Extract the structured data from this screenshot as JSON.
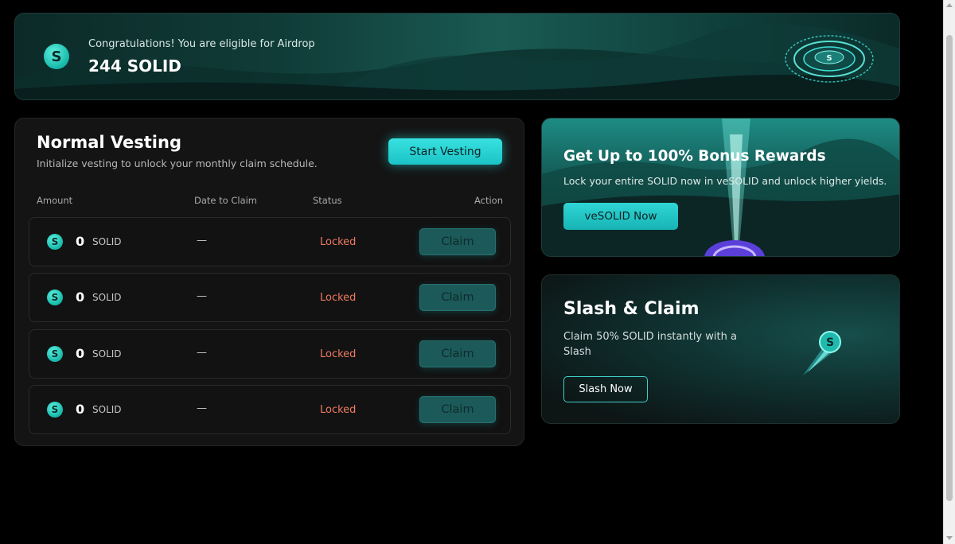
{
  "banner": {
    "subtitle": "Congratulations! You are eligible for Airdrop",
    "amount": "244 SOLID",
    "logo_icon": "solid-logo-icon",
    "ring_icon": "portal-ring-icon"
  },
  "vesting": {
    "title": "Normal Vesting",
    "description": "Initialize vesting to unlock your monthly claim schedule.",
    "start_button": "Start Vesting",
    "columns": [
      "Amount",
      "Date to Claim",
      "Status",
      "Action"
    ],
    "rows": [
      {
        "amount": "0",
        "unit": "SOLID",
        "date": "—",
        "status": "Locked",
        "action": "Claim"
      },
      {
        "amount": "0",
        "unit": "SOLID",
        "date": "—",
        "status": "Locked",
        "action": "Claim"
      },
      {
        "amount": "0",
        "unit": "SOLID",
        "date": "—",
        "status": "Locked",
        "action": "Claim"
      },
      {
        "amount": "0",
        "unit": "SOLID",
        "date": "—",
        "status": "Locked",
        "action": "Claim"
      }
    ]
  },
  "bonus": {
    "title": "Get Up to 100% Bonus Rewards",
    "description": "Lock your entire SOLID now in veSOLID and unlock higher yields.",
    "button": "veSOLID Now"
  },
  "slash": {
    "title": "Slash & Claim",
    "description": "Claim 50% SOLID instantly with a Slash",
    "button": "Slash Now",
    "icon": "comet-coin-icon"
  },
  "colors": {
    "accent": "#2fd6d4",
    "locked": "#f07a62",
    "background": "#000000",
    "panel": "#141414"
  }
}
